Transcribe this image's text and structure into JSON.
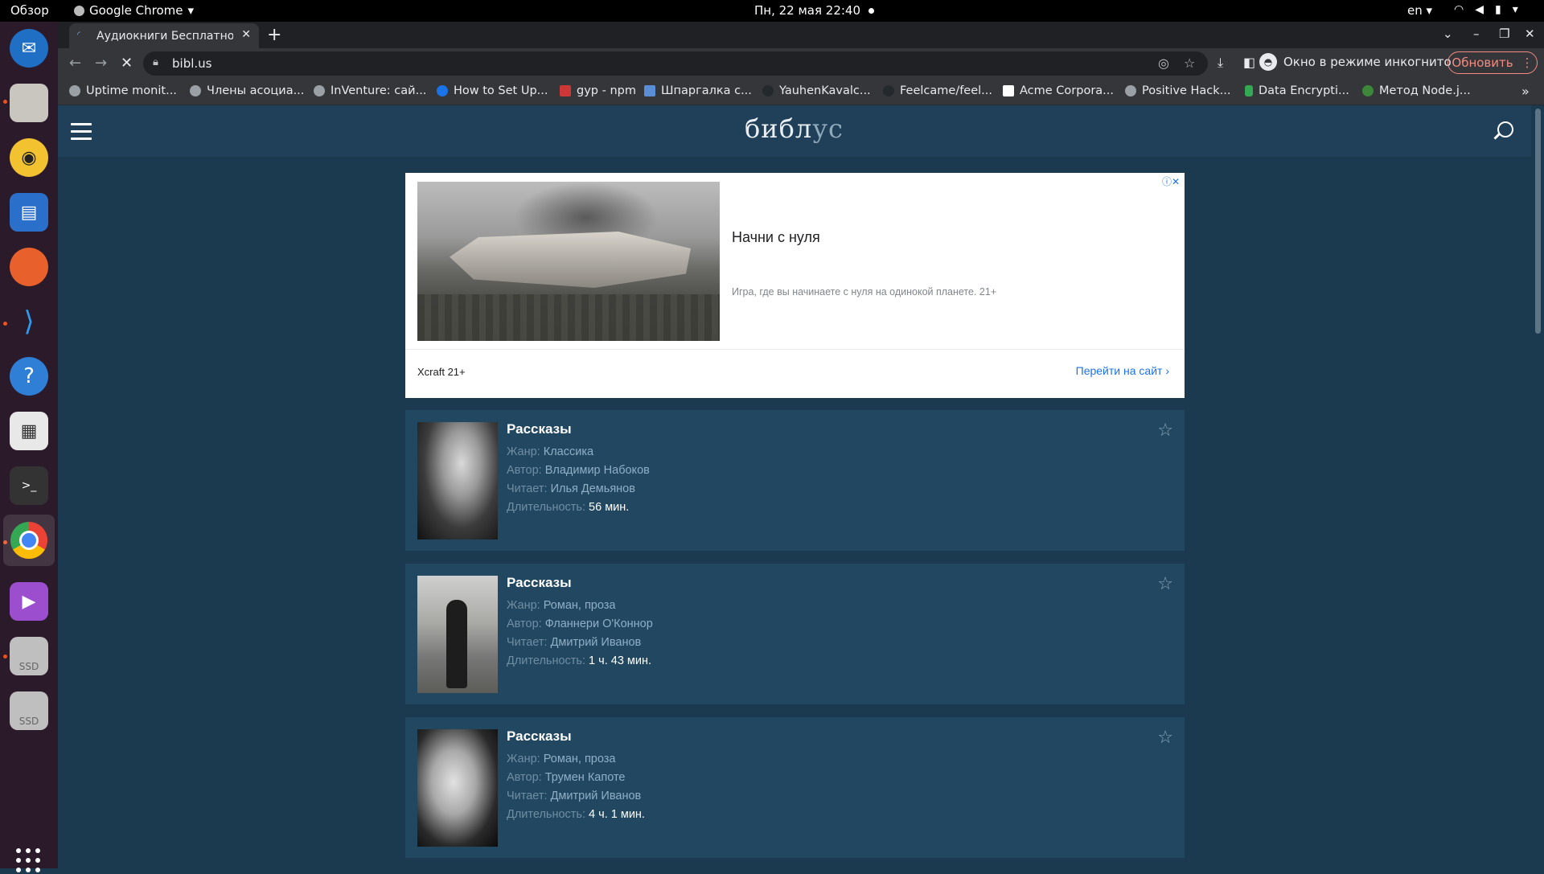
{
  "topbar": {
    "activities": "Обзор",
    "app_name": "Google Chrome",
    "datetime": "Пн, 22 мая  22:40",
    "lang": "en"
  },
  "dock": {
    "apps": [
      "thunderbird",
      "files",
      "rhythmbox",
      "writer",
      "firefox",
      "vscode",
      "help",
      "document-viewer",
      "terminal",
      "chrome",
      "media-player",
      "ssd-drive",
      "ssd-drive-2"
    ],
    "ssd_label": "SSD"
  },
  "browser": {
    "tab_title": "Аудиокниги Бесплатно с",
    "url": "bibl.us",
    "incognito_label": "Окно в режиме инкогнито",
    "update_label": "Обновить",
    "bookmarks": [
      "Uptime monit...",
      "Члены асоциа...",
      "InVenture: сай...",
      "How to Set Up...",
      "gyp - npm",
      "Шпаргалка с...",
      "YauhenKavalc...",
      "Feelcame/feel...",
      "Acme Corpora...",
      "Positive Hack...",
      "Data Encrypti...",
      "Метод Node.j..."
    ]
  },
  "site": {
    "logo_part1": "библ",
    "logo_part2": "ус"
  },
  "ad": {
    "headline": "Начни с нуля",
    "description": "Игра, где вы начинаете с нуля на одинокой планете. 21+",
    "advertiser": "Xcraft 21+",
    "cta": "Перейти на сайт"
  },
  "labels": {
    "genre": "Жанр:",
    "author": "Автор:",
    "reader": "Читает:",
    "duration": "Длительность:"
  },
  "books": [
    {
      "title": "Рассказы",
      "genre": "Классика",
      "author": "Владимир Набоков",
      "reader": "Илья Демьянов",
      "duration": "56 мин."
    },
    {
      "title": "Рассказы",
      "genre": "Роман, проза",
      "author": "Фланнери О'Коннор",
      "reader": "Дмитрий Иванов",
      "duration": "1 ч. 43 мин."
    },
    {
      "title": "Рассказы",
      "genre": "Роман, проза",
      "author": "Трумен Капоте",
      "reader": "Дмитрий Иванов",
      "duration": "4 ч. 1 мин."
    }
  ]
}
